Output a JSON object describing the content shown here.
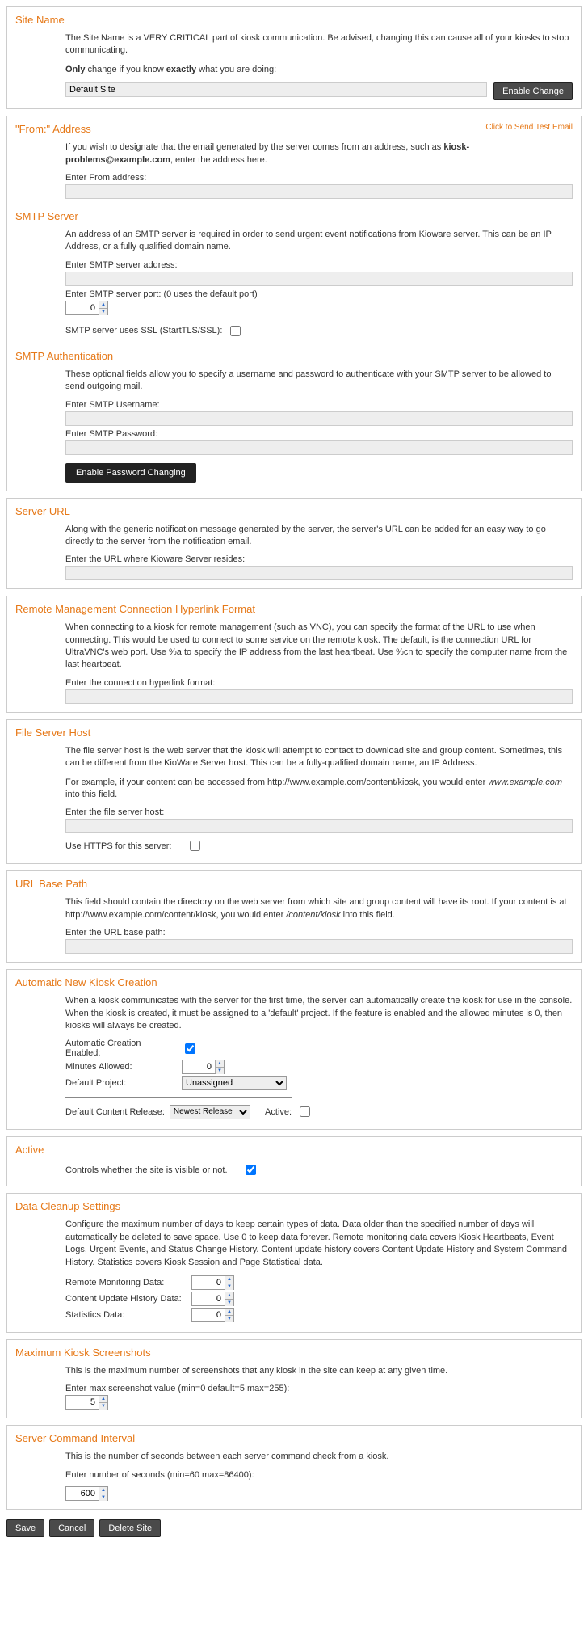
{
  "siteName": {
    "title": "Site Name",
    "desc1a": "The Site Name is a VERY CRITICAL part of kiosk communication.  Be advised, changing this can cause all of your kiosks to stop communicating.",
    "desc2a": "Only",
    "desc2b": " change if you know ",
    "desc2c": "exactly",
    "desc2d": " what you are doing:",
    "value": "Default Site",
    "button": "Enable Change"
  },
  "from": {
    "title": "\"From:\" Address",
    "link": "Click to Send Test Email",
    "desc1a": "If you wish to designate that the email generated by the server comes from an address, such as ",
    "desc1b": "kiosk-problems@example.com",
    "desc1c": ", enter the address here.",
    "label": "Enter From address:"
  },
  "smtp": {
    "title": "SMTP Server",
    "desc": "An address of an SMTP server is required in order to send urgent event notifications from Kioware server. This can be an IP Address, or a fully qualified domain name.",
    "label1": "Enter SMTP server address:",
    "label2": "Enter SMTP server port: (0 uses the default port)",
    "port": "0",
    "ssl": "SMTP server uses SSL (StartTLS/SSL):"
  },
  "smtpAuth": {
    "title": "SMTP Authentication",
    "desc": "These optional fields allow you to specify a username and password to authenticate with your SMTP server to be allowed to send outgoing mail.",
    "userLabel": "Enter SMTP Username:",
    "passLabel": "Enter SMTP Password:",
    "button": "Enable Password Changing"
  },
  "serverUrl": {
    "title": "Server URL",
    "desc": "Along with the generic notification message generated by the server, the server's URL can be added for an easy way to go directly to the server from the notification email.",
    "label": "Enter the URL where Kioware Server resides:"
  },
  "remote": {
    "title": "Remote Management Connection Hyperlink Format",
    "desc": "When connecting to a kiosk for remote management (such as VNC), you can specify the format of the URL to use when connecting. This would be used to connect to some service on the remote kiosk. The default, is the connection URL for UltraVNC's web port. Use %a to specify the IP address from the last heartbeat. Use %cn to specify the computer name from the last heartbeat.",
    "label": "Enter the connection hyperlink format:"
  },
  "fileServer": {
    "title": "File Server Host",
    "desc1": "The file server host is the web server that the kiosk will attempt to contact to download site and group content. Sometimes, this can be different from the KioWare Server host. This can be a fully-qualified domain name, an IP Address.",
    "desc2a": "For example, if your content can be accessed from http://www.example.com/content/kiosk, you would enter ",
    "desc2b": "www.example.com",
    "desc2c": " into this field.",
    "label": "Enter the file server host:",
    "https": "Use HTTPS for this server:"
  },
  "basePath": {
    "title": "URL Base Path",
    "desc1a": "This field should contain the directory on the web server from which site and group content will have its root. If your content is at http://www.example.com/content/kiosk, you would enter ",
    "desc1b": "/content/kiosk",
    "desc1c": " into this field.",
    "label": "Enter the URL base path:"
  },
  "autoKiosk": {
    "title": "Automatic New Kiosk Creation",
    "desc": "When a kiosk communicates with the server for the first time, the server can automatically create the kiosk for use in the console. When the kiosk is created, it must be assigned to a 'default' project. If the feature is enabled and the allowed minutes is 0, then kiosks will always be created.",
    "enabled": "Automatic Creation Enabled:",
    "minutes": "Minutes Allowed:",
    "minutesVal": "0",
    "project": "Default Project:",
    "projectVal": "Unassigned",
    "release": "Default Content Release:",
    "releaseVal": "Newest Release",
    "active": "Active:"
  },
  "active": {
    "title": "Active",
    "desc": "Controls whether the site is visible or not."
  },
  "cleanup": {
    "title": "Data Cleanup Settings",
    "desc": "Configure the maximum number of days to keep certain types of data. Data older than the specified number of days will automatically be deleted to save space. Use 0 to keep data forever. Remote monitoring data covers Kiosk Heartbeats, Event Logs, Urgent Events, and Status Change History. Content update history covers Content Update History and System Command History. Statistics covers Kiosk Session and Page Statistical data.",
    "remote": "Remote Monitoring Data:",
    "remoteVal": "0",
    "content": "Content Update History Data:",
    "contentVal": "0",
    "stats": "Statistics Data:",
    "statsVal": "0"
  },
  "screenshots": {
    "title": "Maximum Kiosk Screenshots",
    "desc": "This is the maximum number of screenshots that any kiosk in the site can keep at any given time.",
    "label": "Enter max screenshot value (min=0 default=5 max=255):",
    "val": "5"
  },
  "interval": {
    "title": "Server Command Interval",
    "desc": "This is the number of seconds between each server command check from a kiosk.",
    "label": "Enter number of seconds (min=60 max=86400):",
    "val": "600"
  },
  "buttons": {
    "save": "Save",
    "cancel": "Cancel",
    "delete": "Delete Site"
  }
}
